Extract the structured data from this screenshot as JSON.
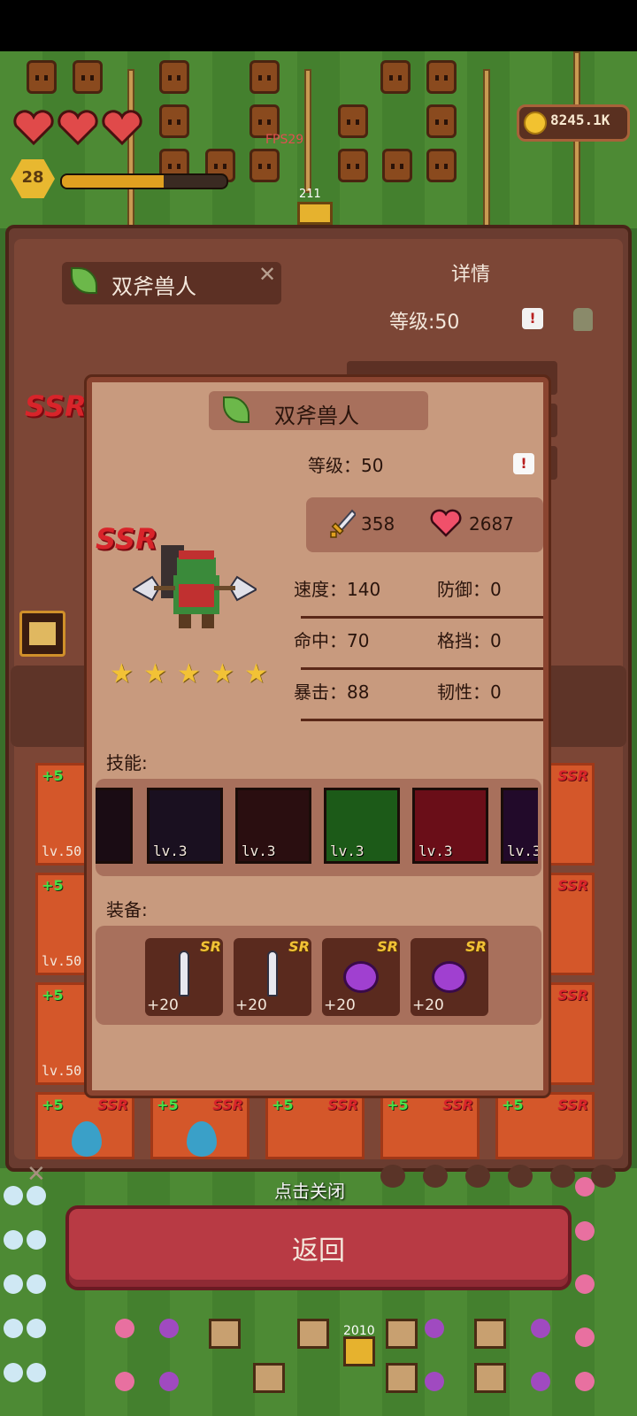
{
  "hud": {
    "coins": "8245.1K",
    "fps": "FPS29",
    "player_level": "28",
    "xp_progress": 0.62,
    "field_count_top": "211",
    "field_count_bottom": "2010"
  },
  "back_panel": {
    "hero_name": "双斧兽人",
    "details_title": "详情",
    "level": "等级:50",
    "rarity": "SSR",
    "alert": "!",
    "cards": [
      {
        "plus": "+5",
        "lv": "lv.50"
      },
      {
        "plus": "+5",
        "lv": "lv.50"
      },
      {
        "plus": "+5",
        "lv": "lv.50"
      }
    ],
    "bottom_cards": [
      "+5",
      "+5",
      "+5",
      "+5",
      "+5"
    ],
    "card_rarity": "SSR"
  },
  "modal": {
    "hero_name": "双斧兽人",
    "rarity": "SSR",
    "level": "等级：50",
    "alert": "!",
    "attack": "358",
    "hp": "2687",
    "stars": 5,
    "stats": [
      {
        "left": "速度：140",
        "right": "防御：0"
      },
      {
        "left": "命中：70",
        "right": "格挡：0"
      },
      {
        "left": "暴击：88",
        "right": "韧性：0"
      }
    ],
    "skills_label": "技能:",
    "skills": [
      {
        "lv": "",
        "icon": "thorn-whip-icon",
        "color": "#1a0c14"
      },
      {
        "lv": "lv.3",
        "icon": "bloody-blade-icon",
        "color": "#1a1020"
      },
      {
        "lv": "lv.3",
        "icon": "shield-icon",
        "color": "#2a0e10"
      },
      {
        "lv": "lv.3",
        "icon": "arrow-rain-icon",
        "color": "#1c5a18"
      },
      {
        "lv": "lv.3",
        "icon": "blood-burst-icon",
        "color": "#6a0e18"
      },
      {
        "lv": "lv.3",
        "icon": "purple-vortex-icon",
        "color": "#220a2a"
      }
    ],
    "equip_label": "装备:",
    "equipment": [
      {
        "rarity": "SR",
        "plus": "+20",
        "icon": "dagger-icon"
      },
      {
        "rarity": "SR",
        "plus": "+20",
        "icon": "dagger-icon"
      },
      {
        "rarity": "SR",
        "plus": "+20",
        "icon": "purple-orb-icon"
      },
      {
        "rarity": "SR",
        "plus": "+20",
        "icon": "purple-orb-icon"
      }
    ]
  },
  "footer": {
    "tap_to_close": "点击关闭",
    "return_button": "返回"
  },
  "colors": {
    "panel": "#6a3c30",
    "modal": "#c89a7e",
    "return_button": "#b83a44",
    "ssr_red": "#d8242a",
    "sr_gold": "#f2c236"
  }
}
